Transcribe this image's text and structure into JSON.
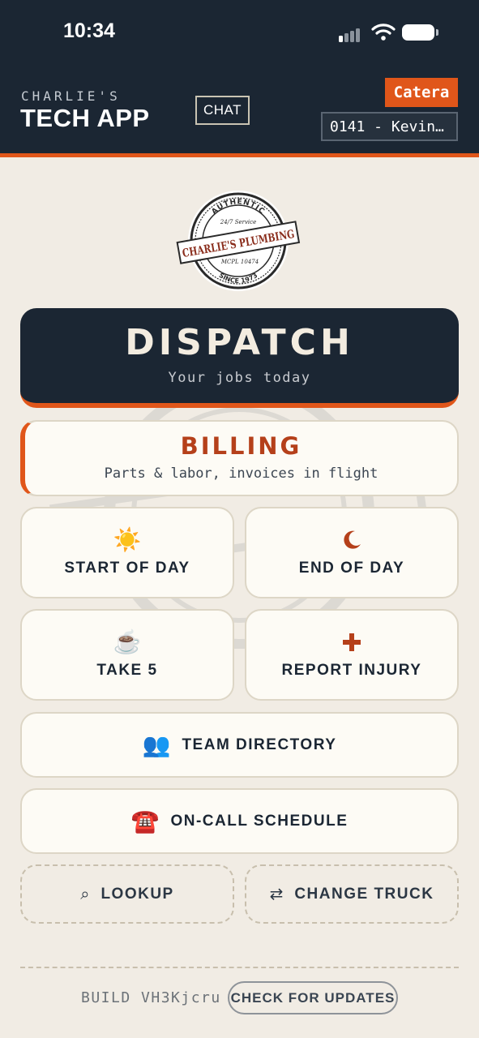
{
  "status_bar": {
    "time": "10:34"
  },
  "header": {
    "brand_top": "CHARLIE'S",
    "brand_main": "TECH APP",
    "chat_label": "CHAT",
    "catera_label": "Catera",
    "tech_select_value": "0141 - Kevin…"
  },
  "logo": {
    "top_text": "AUTHENTIC",
    "service_text": "24/7 Service",
    "name_text": "CHARLIE'S PLUMBING",
    "license_text": "MCPL 10474",
    "since_text": "SINCE 1973"
  },
  "dispatch": {
    "title": "DISPATCH",
    "subtitle": "Your jobs today"
  },
  "billing": {
    "title": "BILLING",
    "subtitle": "Parts & labor, invoices in flight"
  },
  "tiles": {
    "start_of_day": {
      "icon": "☀️",
      "label": "START OF DAY"
    },
    "end_of_day": {
      "icon": "🌙",
      "label": "END OF DAY"
    },
    "take_5": {
      "icon": "☕",
      "label": "TAKE 5"
    },
    "report_injury": {
      "icon": "+",
      "label": "REPORT INJURY"
    },
    "team_directory": {
      "icon": "👥",
      "label": "TEAM DIRECTORY"
    },
    "on_call_schedule": {
      "icon": "☎️",
      "label": "ON-CALL SCHEDULE"
    },
    "lookup": {
      "icon": "⌕",
      "label": "LOOKUP"
    },
    "change_truck": {
      "icon": "⇄",
      "label": "CHANGE TRUCK"
    }
  },
  "footer": {
    "build_text": "BUILD VH3Kjcru",
    "update_label": "CHECK FOR UPDATES"
  },
  "colors": {
    "navy": "#1b2633",
    "accent_orange": "#e0561a",
    "billing_rust": "#b5401a",
    "background": "#f1ece4",
    "card": "#fdfbf5"
  }
}
